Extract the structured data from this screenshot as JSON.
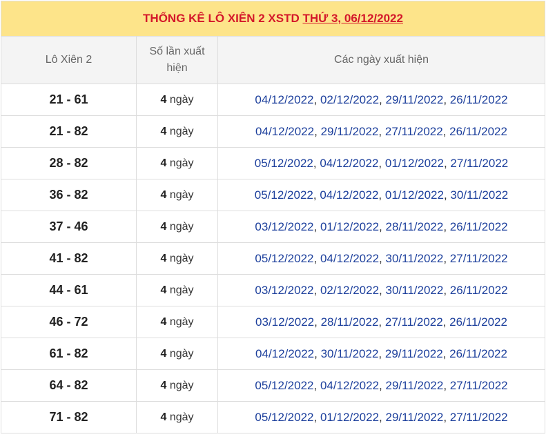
{
  "title": {
    "main": "THỐNG KÊ LÔ XIÊN 2 XSTD",
    "link": "THỨ 3, 06/12/2022"
  },
  "headers": {
    "pair": "Lô Xiên 2",
    "count": "Số lần xuất hiện",
    "dates": "Các ngày xuất hiện"
  },
  "unit": "ngày",
  "rows": [
    {
      "pair": "21 - 61",
      "count": "4",
      "dates": [
        "04/12/2022",
        "02/12/2022",
        "29/11/2022",
        "26/11/2022"
      ]
    },
    {
      "pair": "21 - 82",
      "count": "4",
      "dates": [
        "04/12/2022",
        "29/11/2022",
        "27/11/2022",
        "26/11/2022"
      ]
    },
    {
      "pair": "28 - 82",
      "count": "4",
      "dates": [
        "05/12/2022",
        "04/12/2022",
        "01/12/2022",
        "27/11/2022"
      ]
    },
    {
      "pair": "36 - 82",
      "count": "4",
      "dates": [
        "05/12/2022",
        "04/12/2022",
        "01/12/2022",
        "30/11/2022"
      ]
    },
    {
      "pair": "37 - 46",
      "count": "4",
      "dates": [
        "03/12/2022",
        "01/12/2022",
        "28/11/2022",
        "26/11/2022"
      ]
    },
    {
      "pair": "41 - 82",
      "count": "4",
      "dates": [
        "05/12/2022",
        "04/12/2022",
        "30/11/2022",
        "27/11/2022"
      ]
    },
    {
      "pair": "44 - 61",
      "count": "4",
      "dates": [
        "03/12/2022",
        "02/12/2022",
        "30/11/2022",
        "26/11/2022"
      ]
    },
    {
      "pair": "46 - 72",
      "count": "4",
      "dates": [
        "03/12/2022",
        "28/11/2022",
        "27/11/2022",
        "26/11/2022"
      ]
    },
    {
      "pair": "61 - 82",
      "count": "4",
      "dates": [
        "04/12/2022",
        "30/11/2022",
        "29/11/2022",
        "26/11/2022"
      ]
    },
    {
      "pair": "64 - 82",
      "count": "4",
      "dates": [
        "05/12/2022",
        "04/12/2022",
        "29/11/2022",
        "27/11/2022"
      ]
    },
    {
      "pair": "71 - 82",
      "count": "4",
      "dates": [
        "05/12/2022",
        "01/12/2022",
        "29/11/2022",
        "27/11/2022"
      ]
    }
  ]
}
